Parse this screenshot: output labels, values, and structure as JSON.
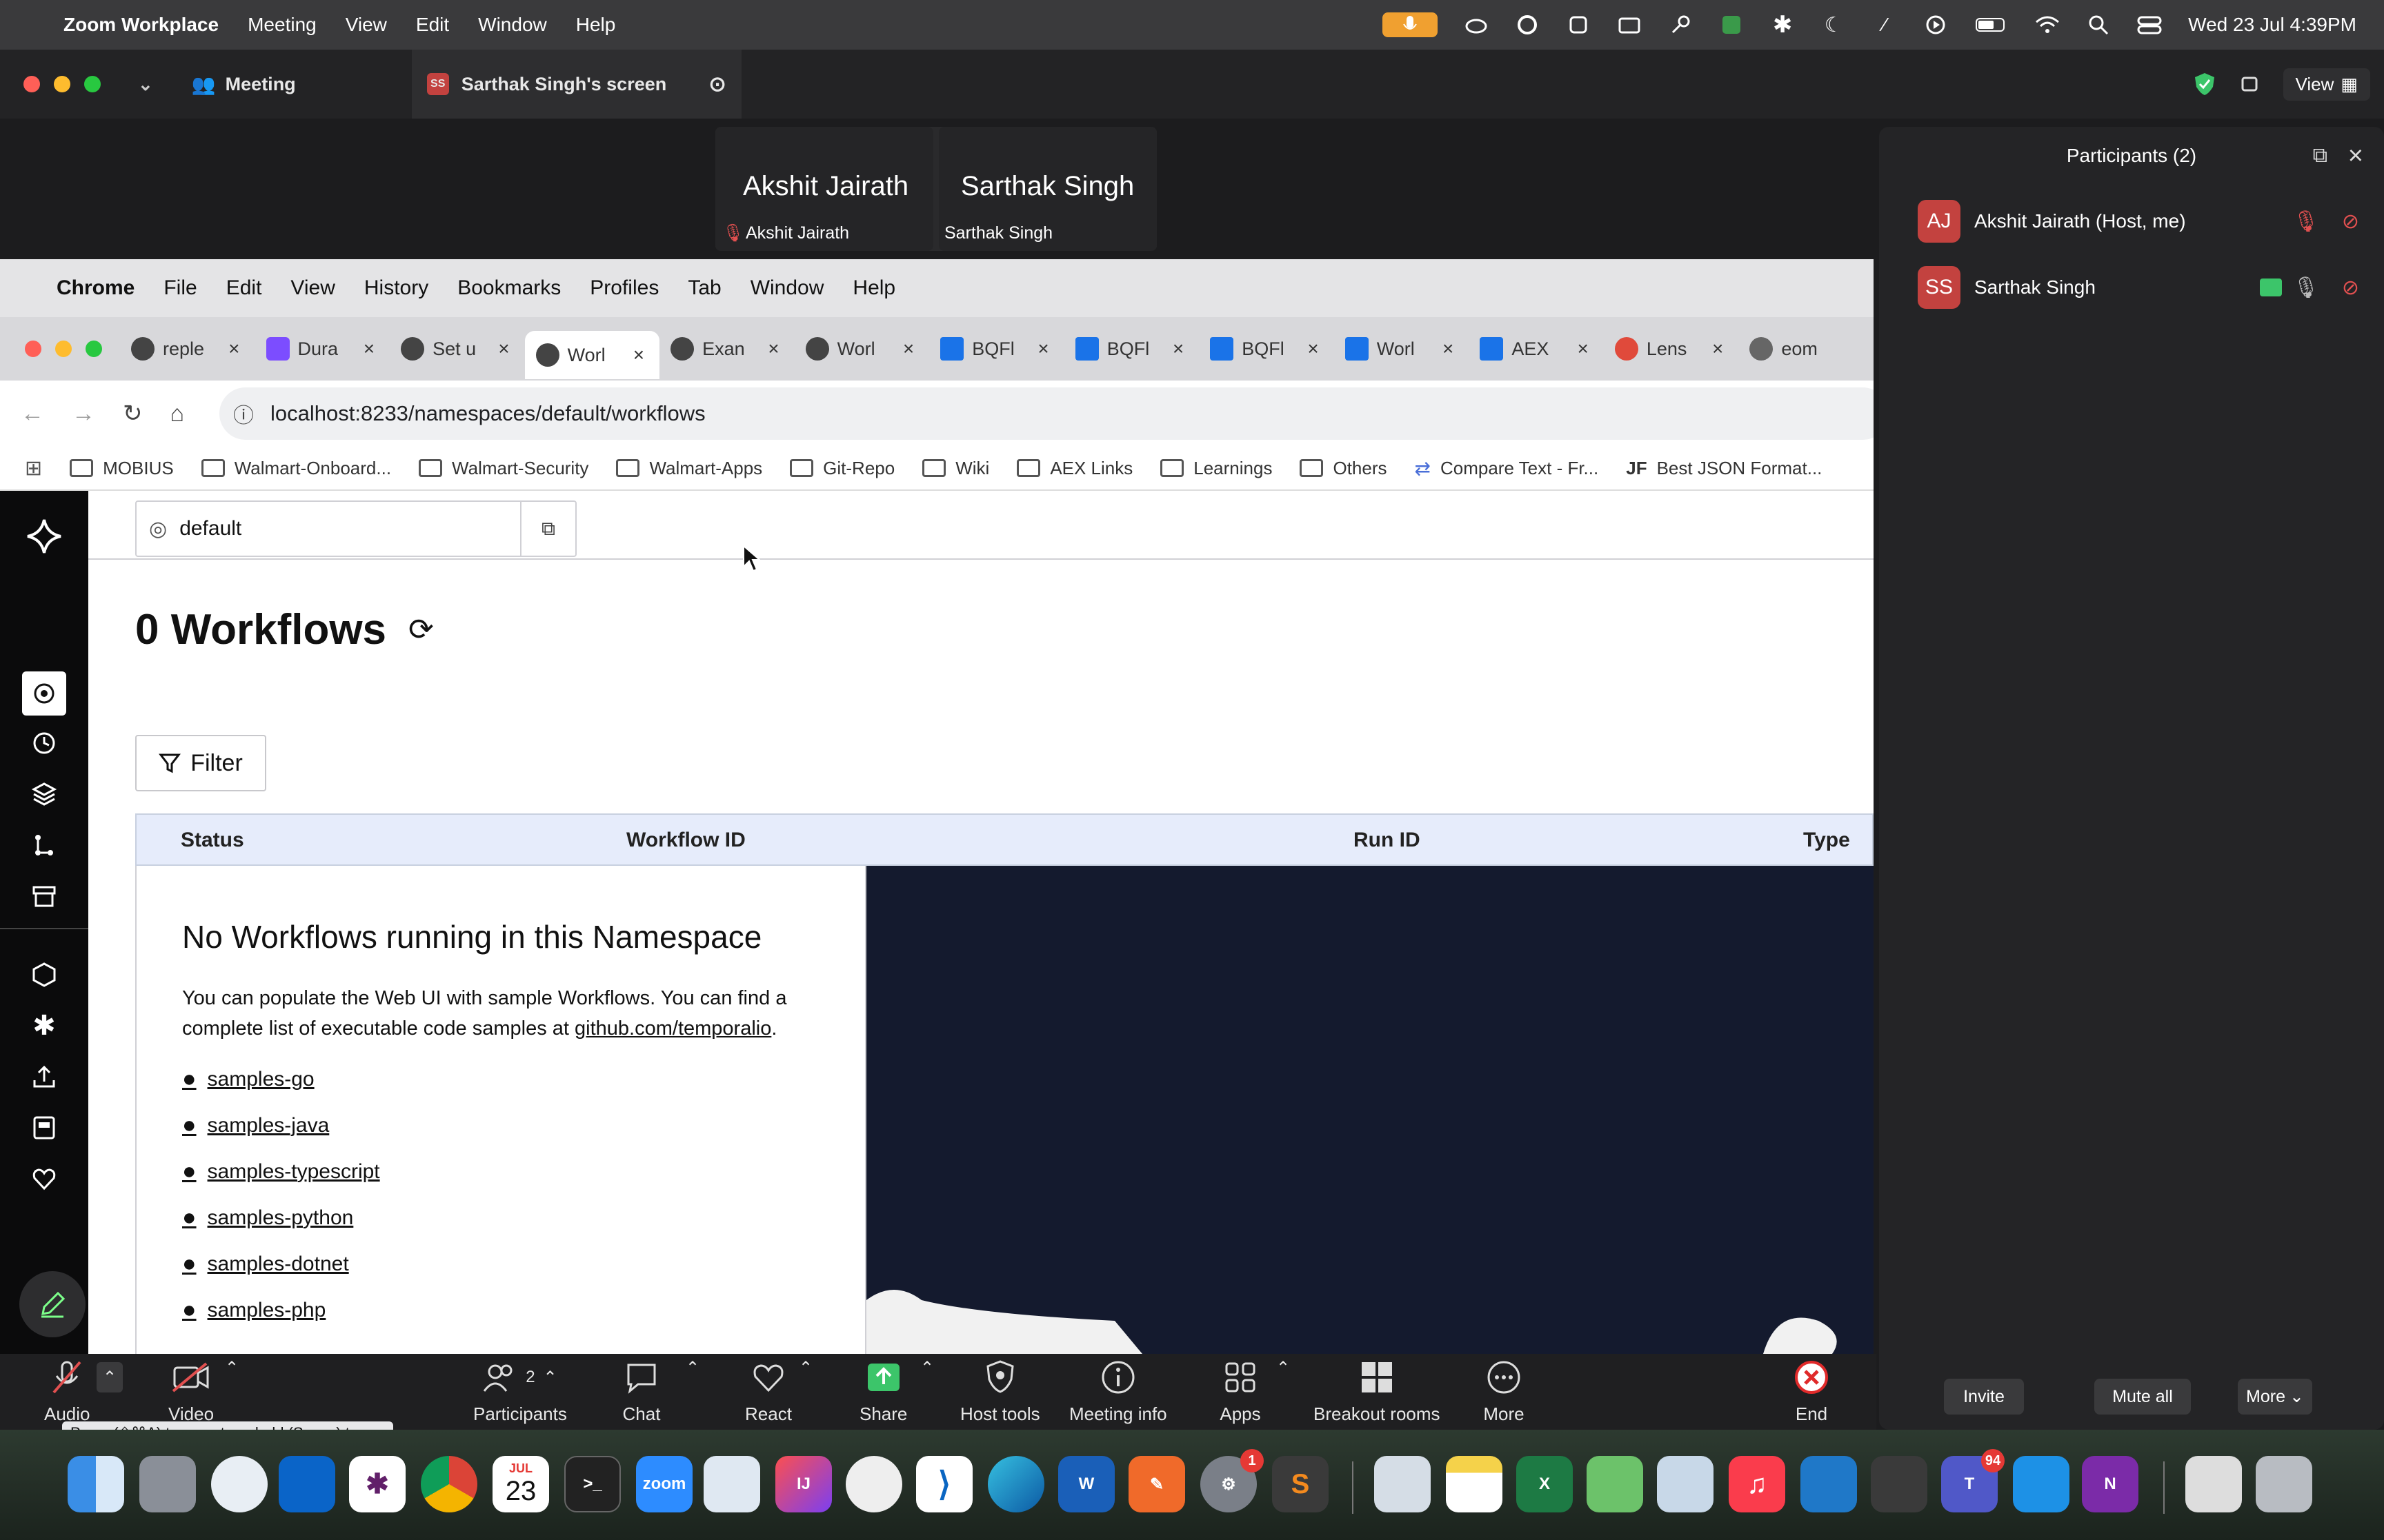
{
  "menubar": {
    "apple": "",
    "app": "Zoom Workplace",
    "items": [
      "Meeting",
      "View",
      "Edit",
      "Window",
      "Help"
    ],
    "datetime": "Wed 23 Jul  4:39PM"
  },
  "zoom_titlebar": {
    "tab_meeting": "Meeting",
    "tab_screen": "Sarthak Singh's screen",
    "screen_avatar": "SS",
    "view_label": "View"
  },
  "video_strip": {
    "tile1_name": "Akshit Jairath",
    "tile1_label": "Akshit Jairath",
    "tile2_name": "Sarthak Singh",
    "tile2_label": "Sarthak Singh"
  },
  "chrome": {
    "menu": [
      "Chrome",
      "File",
      "Edit",
      "View",
      "History",
      "Bookmarks",
      "Profiles",
      "Tab",
      "Window",
      "Help"
    ],
    "tabs": [
      "reple",
      "Dura",
      "Set u",
      "Worl",
      "Exan",
      "Worl",
      "BQFl",
      "BQFl",
      "BQFl",
      "Worl",
      "AEX",
      "Lens",
      "eom"
    ],
    "url": "localhost:8233/namespaces/default/workflows",
    "bookmarks": [
      "MOBIUS",
      "Walmart-Onboard...",
      "Walmart-Security",
      "Walmart-Apps",
      "Git-Repo",
      "Wiki",
      "AEX Links",
      "Learnings",
      "Others",
      "Compare Text - Fr...",
      "Best JSON Format..."
    ]
  },
  "temporal": {
    "namespace": "default",
    "title": "0 Workflows",
    "filter_label": "Filter",
    "columns": [
      "Status",
      "Workflow ID",
      "Run ID",
      "Type"
    ],
    "empty_title": "No Workflows running in this Namespace",
    "empty_text": "You can populate the Web UI with sample Workflows. You can find a complete list of executable code samples at",
    "empty_link": "github.com/temporalio",
    "samples": [
      "samples-go",
      "samples-java",
      "samples-typescript",
      "samples-python",
      "samples-dotnet",
      "samples-php"
    ]
  },
  "participants": {
    "title": "Participants (2)",
    "list": [
      {
        "initials": "AJ",
        "name": "Akshit Jairath (Host, me)"
      },
      {
        "initials": "SS",
        "name": "Sarthak Singh"
      }
    ],
    "invite": "Invite",
    "mute_all": "Mute all",
    "more": "More"
  },
  "toolbar": {
    "audio": "Audio",
    "video": "Video",
    "participants": "Participants",
    "participants_count": "2",
    "chat": "Chat",
    "react": "React",
    "share": "Share",
    "host_tools": "Host tools",
    "meeting_info": "Meeting info",
    "apps": "Apps",
    "breakout_rooms": "Breakout rooms",
    "more": "More",
    "end": "End",
    "tooltip": "Press (⇧⌘A) to unmute or hold (Space) to temporarily unmute."
  },
  "dock": {
    "calendar_month": "JUL",
    "calendar_day": "23",
    "zoom_label": "zoom",
    "teams_badge": "94",
    "settings_badge": "1"
  }
}
